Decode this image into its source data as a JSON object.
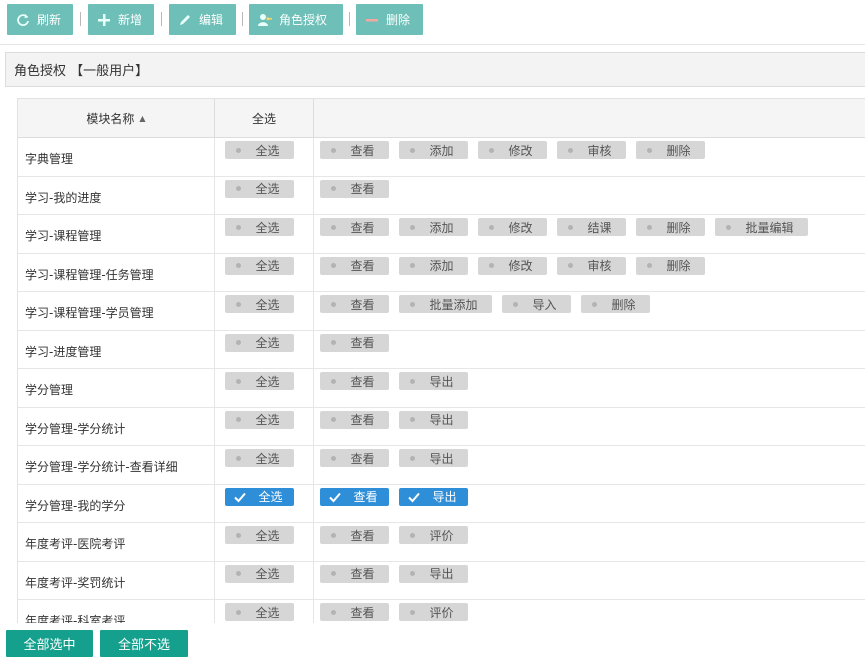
{
  "toolbar": {
    "buttons": [
      {
        "label": "刷新",
        "icon": "refresh-icon"
      },
      {
        "label": "新增",
        "icon": "plus-icon"
      },
      {
        "label": "编辑",
        "icon": "pencil-icon"
      },
      {
        "label": "角色授权",
        "icon": "user-key-icon"
      },
      {
        "label": "删除",
        "icon": "minus-icon"
      }
    ]
  },
  "panel": {
    "title": "角色授权 【一般用户】"
  },
  "grid": {
    "headers": {
      "module": "模块名称",
      "select_all": "全选"
    },
    "sort_icon": "sort-up-icon",
    "rows": [
      {
        "name": "字典管理",
        "all": {
          "label": "全选",
          "checked": false
        },
        "perms": [
          {
            "label": "查看",
            "checked": false
          },
          {
            "label": "添加",
            "checked": false
          },
          {
            "label": "修改",
            "checked": false
          },
          {
            "label": "审核",
            "checked": false
          },
          {
            "label": "删除",
            "checked": false
          }
        ]
      },
      {
        "name": "学习-我的进度",
        "all": {
          "label": "全选",
          "checked": false
        },
        "perms": [
          {
            "label": "查看",
            "checked": false
          }
        ]
      },
      {
        "name": "学习-课程管理",
        "all": {
          "label": "全选",
          "checked": false
        },
        "perms": [
          {
            "label": "查看",
            "checked": false
          },
          {
            "label": "添加",
            "checked": false
          },
          {
            "label": "修改",
            "checked": false
          },
          {
            "label": "结课",
            "checked": false
          },
          {
            "label": "删除",
            "checked": false
          },
          {
            "label": "批量编辑",
            "checked": false
          }
        ]
      },
      {
        "name": "学习-课程管理-任务管理",
        "all": {
          "label": "全选",
          "checked": false
        },
        "perms": [
          {
            "label": "查看",
            "checked": false
          },
          {
            "label": "添加",
            "checked": false
          },
          {
            "label": "修改",
            "checked": false
          },
          {
            "label": "审核",
            "checked": false
          },
          {
            "label": "删除",
            "checked": false
          }
        ]
      },
      {
        "name": "学习-课程管理-学员管理",
        "all": {
          "label": "全选",
          "checked": false
        },
        "perms": [
          {
            "label": "查看",
            "checked": false
          },
          {
            "label": "批量添加",
            "checked": false
          },
          {
            "label": "导入",
            "checked": false
          },
          {
            "label": "删除",
            "checked": false
          }
        ]
      },
      {
        "name": "学习-进度管理",
        "all": {
          "label": "全选",
          "checked": false
        },
        "perms": [
          {
            "label": "查看",
            "checked": false
          }
        ]
      },
      {
        "name": "学分管理",
        "all": {
          "label": "全选",
          "checked": false
        },
        "perms": [
          {
            "label": "查看",
            "checked": false
          },
          {
            "label": "导出",
            "checked": false
          }
        ]
      },
      {
        "name": "学分管理-学分统计",
        "all": {
          "label": "全选",
          "checked": false
        },
        "perms": [
          {
            "label": "查看",
            "checked": false
          },
          {
            "label": "导出",
            "checked": false
          }
        ]
      },
      {
        "name": "学分管理-学分统计-查看详细",
        "all": {
          "label": "全选",
          "checked": false
        },
        "perms": [
          {
            "label": "查看",
            "checked": false
          },
          {
            "label": "导出",
            "checked": false
          }
        ]
      },
      {
        "name": "学分管理-我的学分",
        "all": {
          "label": "全选",
          "checked": true
        },
        "perms": [
          {
            "label": "查看",
            "checked": true
          },
          {
            "label": "导出",
            "checked": true
          }
        ]
      },
      {
        "name": "年度考评-医院考评",
        "all": {
          "label": "全选",
          "checked": false
        },
        "perms": [
          {
            "label": "查看",
            "checked": false
          },
          {
            "label": "评价",
            "checked": false
          }
        ]
      },
      {
        "name": "年度考评-奖罚统计",
        "all": {
          "label": "全选",
          "checked": false
        },
        "perms": [
          {
            "label": "查看",
            "checked": false
          },
          {
            "label": "导出",
            "checked": false
          }
        ]
      },
      {
        "name": "年度考评-科室考评",
        "all": {
          "label": "全选",
          "checked": false
        },
        "perms": [
          {
            "label": "查看",
            "checked": false
          },
          {
            "label": "评价",
            "checked": false
          }
        ]
      }
    ]
  },
  "footer": {
    "select_all_label": "全部选中",
    "deselect_all_label": "全部不选"
  },
  "colors": {
    "toolbar_button": "#6dbfb7",
    "checked": "#2e8fd8",
    "unchecked": "#d6d6d6",
    "footer_button": "#14a08d"
  }
}
